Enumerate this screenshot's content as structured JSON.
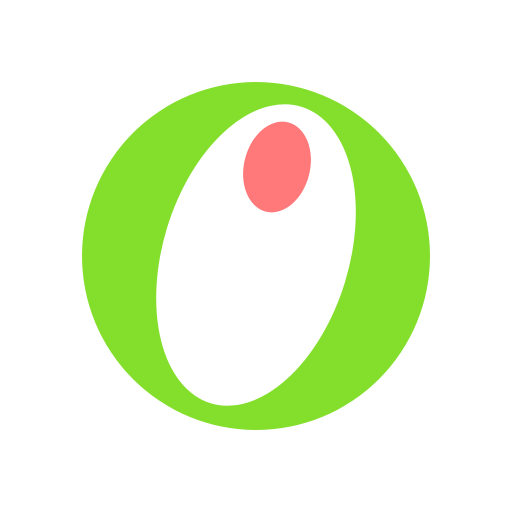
{
  "logo": {
    "outer_color": "#84de2c",
    "inner_color": "#ffffff",
    "dot_color": "#ff787a",
    "icon": "olive-logo-icon"
  }
}
